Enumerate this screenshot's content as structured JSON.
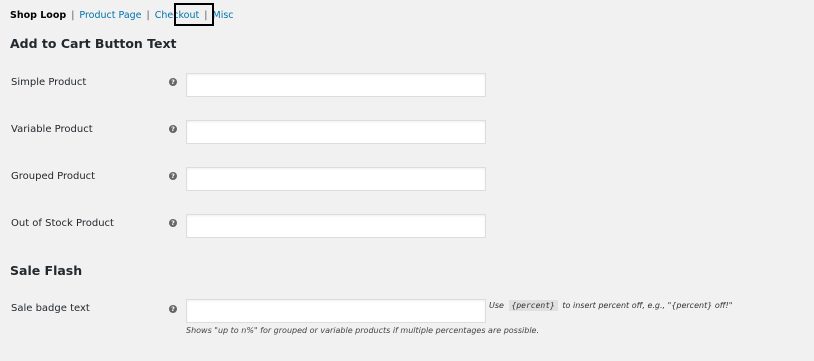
{
  "subnav": {
    "items": [
      {
        "label": "Shop Loop",
        "current": true
      },
      {
        "label": "Product Page",
        "current": false
      },
      {
        "label": "Checkout",
        "current": false
      },
      {
        "label": "Misc",
        "current": false
      }
    ],
    "separator": "|"
  },
  "sections": {
    "add_to_cart": {
      "title": "Add to Cart Button Text",
      "fields": [
        {
          "label": "Simple Product",
          "value": "",
          "help_icon": "question-circle-icon"
        },
        {
          "label": "Variable Product",
          "value": "",
          "help_icon": "question-circle-icon"
        },
        {
          "label": "Grouped Product",
          "value": "",
          "help_icon": "question-circle-icon"
        },
        {
          "label": "Out of Stock Product",
          "value": "",
          "help_icon": "question-circle-icon"
        }
      ]
    },
    "sale_flash": {
      "title": "Sale Flash",
      "fields": [
        {
          "label": "Sale badge text",
          "value": "",
          "help_icon": "question-circle-icon",
          "note_before": "Use",
          "note_code": "{percent}",
          "note_after": "to insert percent off, e.g., \"{percent} off!\"",
          "description": "Shows \"up to n%\" for grouped or variable products if multiple percentages are possible."
        }
      ]
    }
  },
  "icons": {
    "help": "?"
  },
  "colors": {
    "link": "#0073aa",
    "background": "#f1f1f1",
    "highlight_border": "#000000"
  }
}
